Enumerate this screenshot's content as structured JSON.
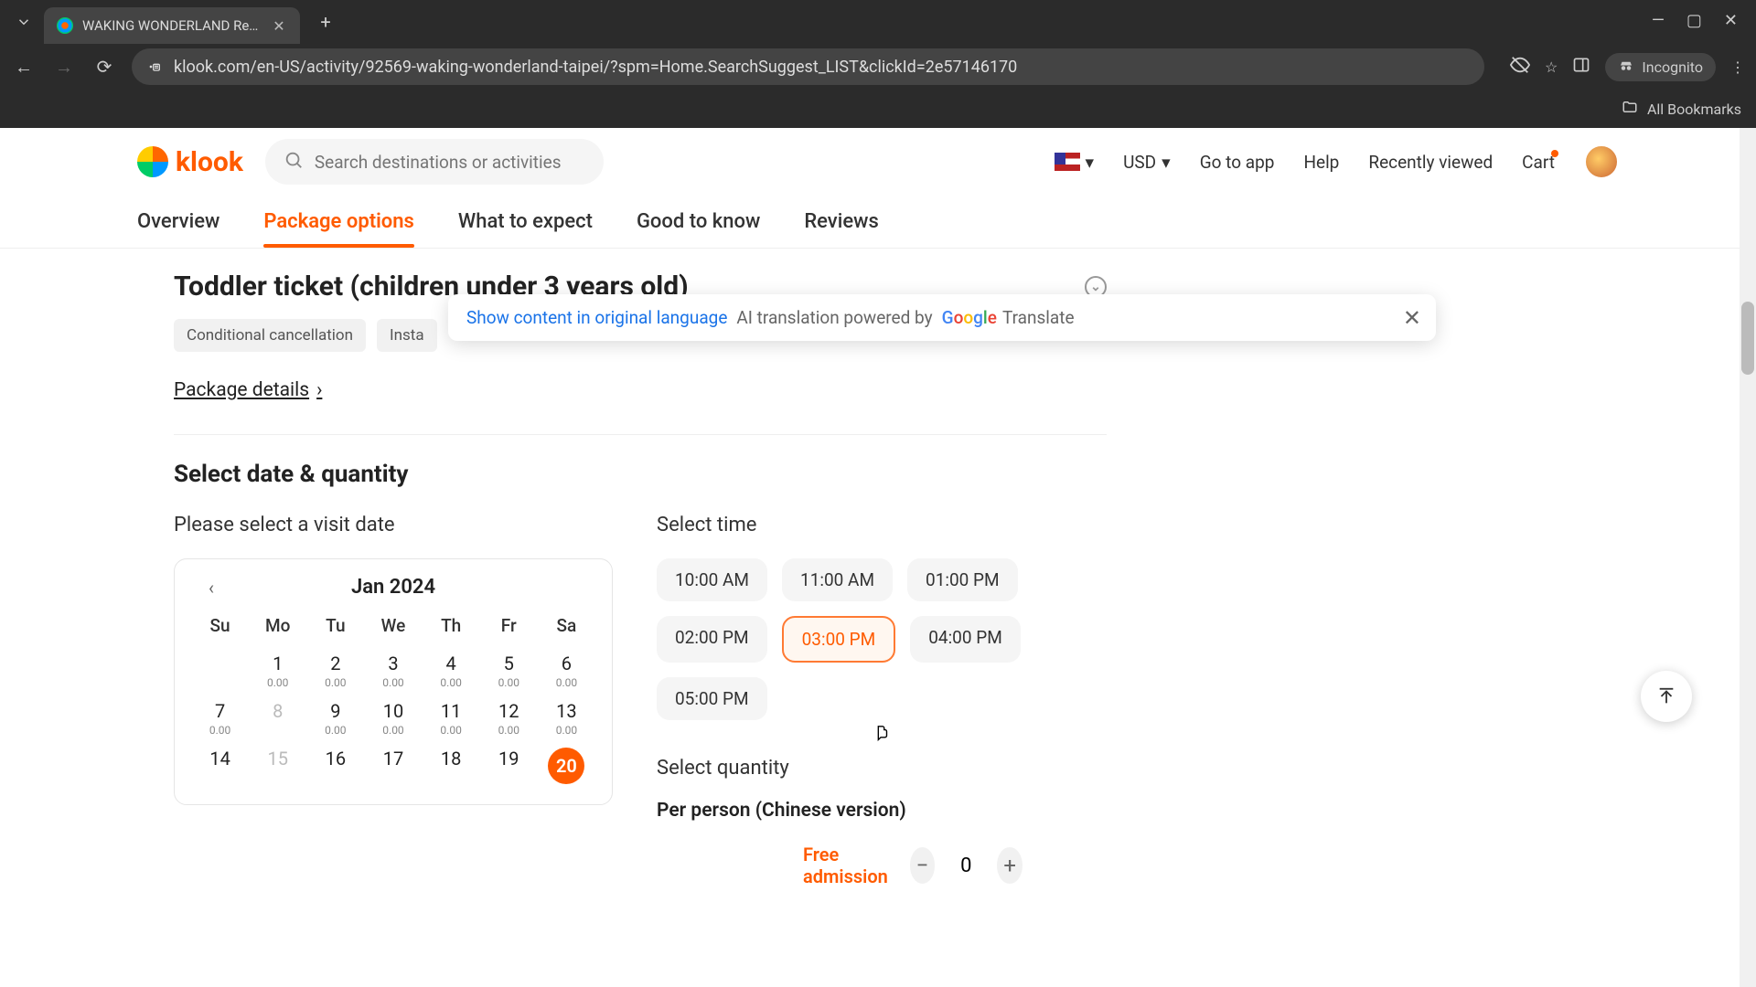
{
  "browser": {
    "tab_title": "WAKING WONDERLAND Revis…",
    "url": "klook.com/en-US/activity/92569-waking-wonderland-taipei/?spm=Home.SearchSuggest_LIST&clickId=2e57146170",
    "incognito_label": "Incognito",
    "bookmarks_label": "All Bookmarks"
  },
  "header": {
    "logo_text": "klook",
    "search_placeholder": "Search destinations or activities",
    "currency": "USD",
    "go_to_app": "Go to app",
    "help": "Help",
    "recently_viewed": "Recently viewed",
    "cart": "Cart"
  },
  "tabs": {
    "overview": "Overview",
    "package": "Package options",
    "expect": "What to expect",
    "know": "Good to know",
    "reviews": "Reviews"
  },
  "translate": {
    "link": "Show content in original language",
    "powered": "AI translation powered by",
    "google": "Google",
    "translate": "Translate"
  },
  "package": {
    "title": "Toddler ticket (children under 3 years old)",
    "chip1": "Conditional cancellation",
    "chip2": "Insta",
    "details": "Package details"
  },
  "select": {
    "title": "Select date & quantity",
    "date_label": "Please select a visit date",
    "time_label": "Select time",
    "qty_label": "Select quantity",
    "per_person": "Per person (Chinese version)",
    "free": "Free admission",
    "qty_value": "0"
  },
  "calendar": {
    "month": "Jan 2024",
    "dow": [
      "Su",
      "Mo",
      "Tu",
      "We",
      "Th",
      "Fr",
      "Sa"
    ],
    "weeks": [
      [
        {
          "n": "",
          "p": ""
        },
        {
          "n": "1",
          "p": "0.00"
        },
        {
          "n": "2",
          "p": "0.00"
        },
        {
          "n": "3",
          "p": "0.00"
        },
        {
          "n": "4",
          "p": "0.00"
        },
        {
          "n": "5",
          "p": "0.00"
        },
        {
          "n": "6",
          "p": "0.00"
        }
      ],
      [
        {
          "n": "7",
          "p": "0.00"
        },
        {
          "n": "8",
          "p": "",
          "dim": true
        },
        {
          "n": "9",
          "p": "0.00"
        },
        {
          "n": "10",
          "p": "0.00"
        },
        {
          "n": "11",
          "p": "0.00"
        },
        {
          "n": "12",
          "p": "0.00"
        },
        {
          "n": "13",
          "p": "0.00"
        }
      ],
      [
        {
          "n": "14",
          "p": ""
        },
        {
          "n": "15",
          "p": "",
          "dim": true
        },
        {
          "n": "16",
          "p": ""
        },
        {
          "n": "17",
          "p": ""
        },
        {
          "n": "18",
          "p": ""
        },
        {
          "n": "19",
          "p": ""
        },
        {
          "n": "20",
          "p": "",
          "sel": true
        }
      ]
    ]
  },
  "times": [
    "10:00 AM",
    "11:00 AM",
    "01:00 PM",
    "02:00 PM",
    "03:00 PM",
    "04:00 PM",
    "05:00 PM"
  ],
  "time_selected": "03:00 PM"
}
